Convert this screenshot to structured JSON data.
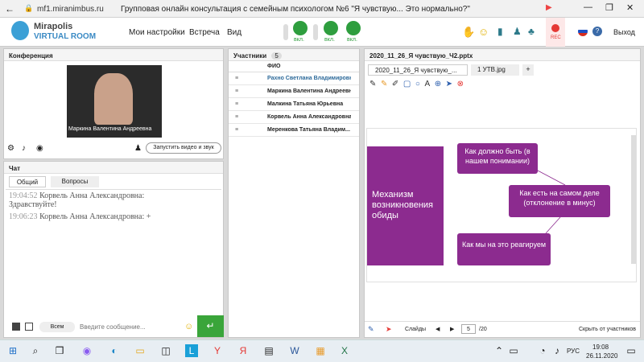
{
  "browser": {
    "url": "mf1.miranimbus.ru",
    "title": "Групповая онлайн консультация с семейным психологом №6 \"Я чувствую... Это нормально?\""
  },
  "app": {
    "logo_top": "Mirapolis",
    "logo_bottom": "VIRTUAL ROOM",
    "menu": [
      "Мои настройки",
      "Встреча",
      "Вид"
    ],
    "mic_label": "вкл.",
    "cam_label": "вкл.",
    "screen_label": "вкл.",
    "rec_label": "REC",
    "exit_label": "Выход"
  },
  "conference": {
    "title": "Конференция",
    "video_name": "Маркина Валентина  Андреевна",
    "start_video_label": "Запустить видео и звук"
  },
  "chat": {
    "title": "Чат",
    "tabs": [
      "Общий",
      "Вопросы"
    ],
    "messages": [
      {
        "time": "19:04:52",
        "author": "Корвель Анна  Александровна:",
        "text": "Здравствуйте!"
      },
      {
        "time": "19:06:23",
        "author": "Корвель Анна  Александровна:",
        "text": "+"
      }
    ],
    "recipient": "Всем",
    "placeholder": "Введите сообщение..."
  },
  "participants": {
    "title": "Участники",
    "count": "5",
    "col_header": "ФИО",
    "rows": [
      "Рахно Светлана  Владимировна",
      "Маркина Валентина  Андреевна",
      "Малкина Татьяна  Юрьевна",
      "Корвель Анна  Александровна",
      "Меренкова  Татьяна  Владим..."
    ]
  },
  "presentation": {
    "title": "2020_11_26_Я чувствую_Ч2.pptx",
    "tabs": [
      "2020_11_26_Я чувствую_...",
      "1 УТВ.jpg",
      "+"
    ],
    "slide": {
      "left_box": "Механизм возникновения обиды",
      "box1": "Как должно быть (в нашем понимании)",
      "box2": "Как есть на самом деле (отклонение в минус)",
      "box3": "Как мы на это реагируем"
    },
    "slides_label": "Слайды",
    "current_slide": "5",
    "total_slides": "/20",
    "hide_participants": "Скрыть от участников"
  },
  "taskbar": {
    "lang": "РУС",
    "time": "19:08",
    "date": "26.11.2020"
  },
  "colors": {
    "accent": "#2e9e3e",
    "slide": "#8c2b8f",
    "rec": "#e53935"
  }
}
